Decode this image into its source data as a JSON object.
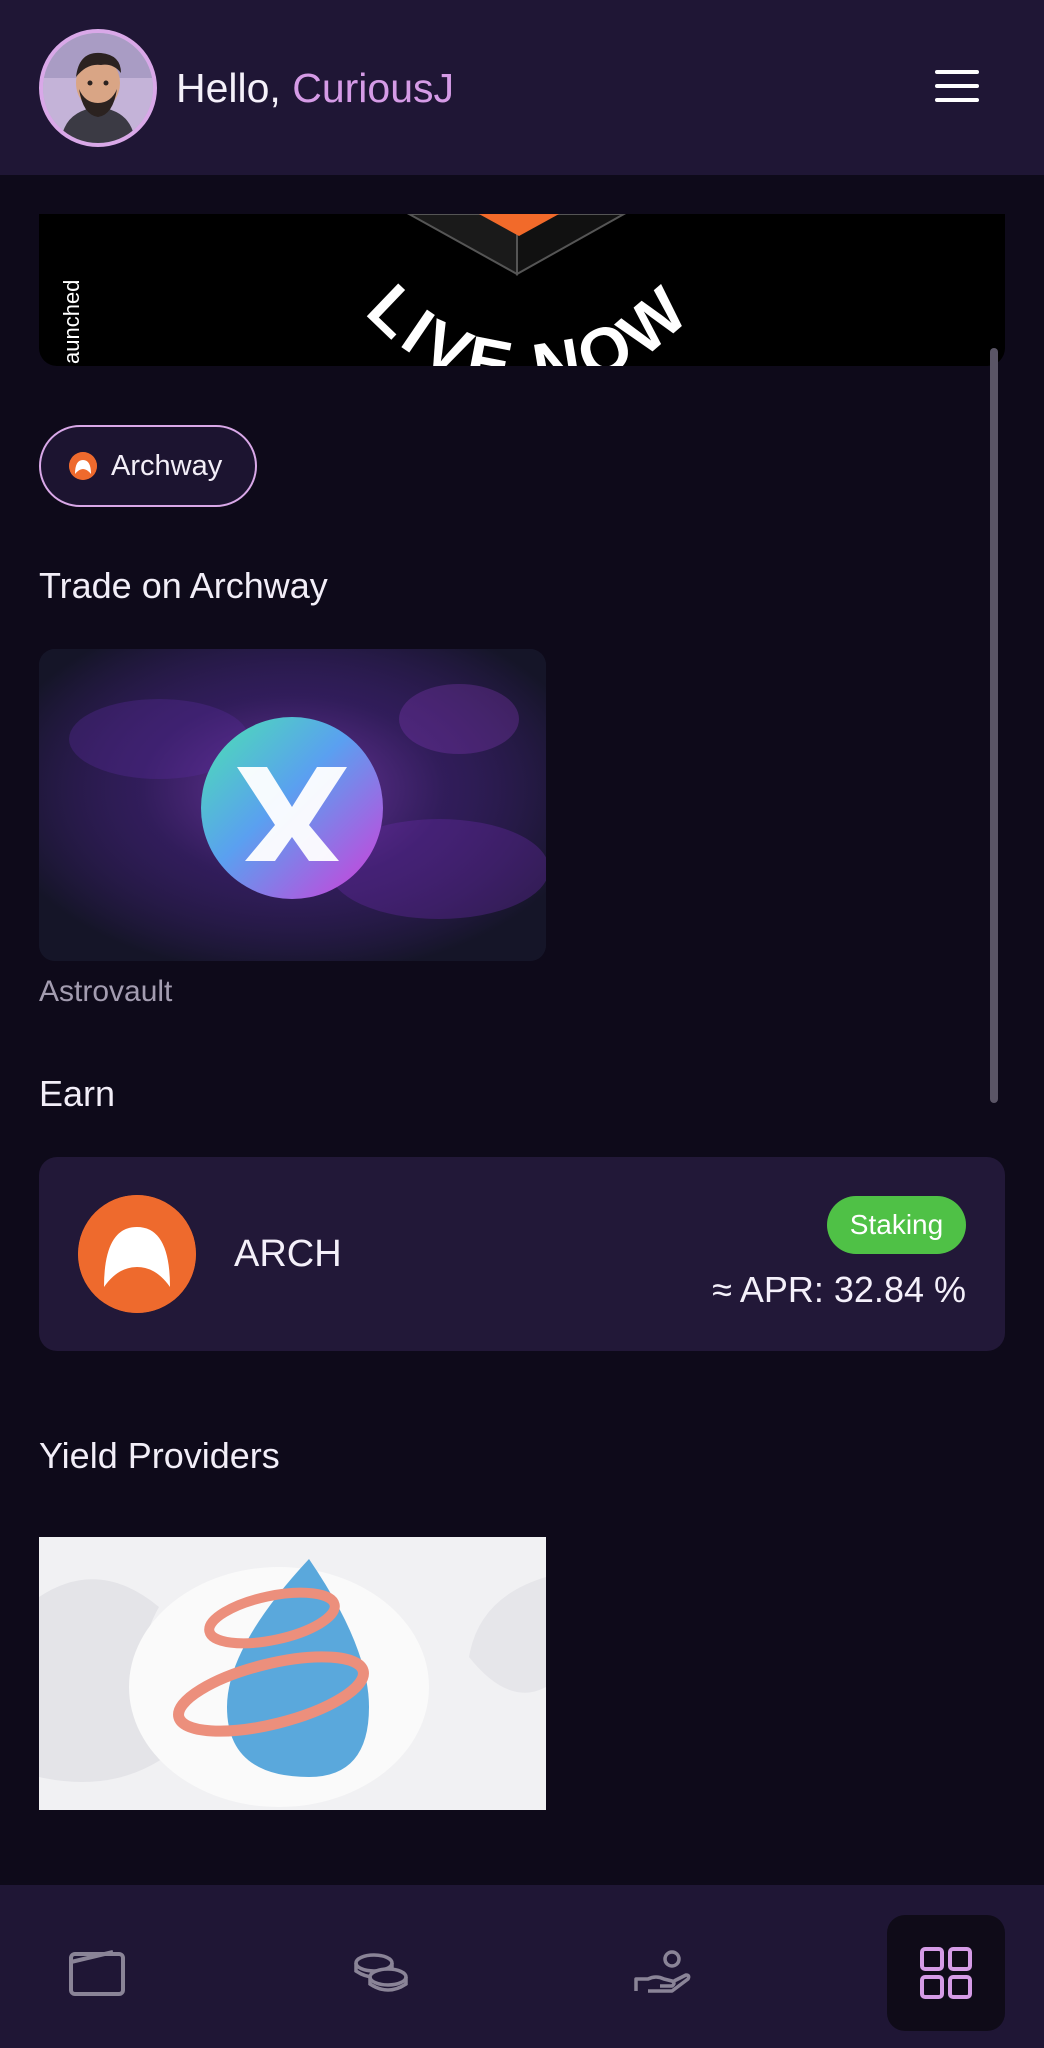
{
  "header": {
    "greeting_prefix": "Hello,",
    "username": "CuriousJ",
    "avatar_icon": "user-avatar",
    "menu_icon": "hamburger-menu-icon"
  },
  "banner": {
    "side_text": "aunched",
    "arc_text": "LIVE NOW"
  },
  "network_chip": {
    "label": "Archway",
    "icon": "archway-logo-icon"
  },
  "trade": {
    "title": "Trade on Archway",
    "apps": [
      {
        "name": "Astrovault",
        "icon": "astrovault-logo"
      }
    ]
  },
  "earn": {
    "title": "Earn",
    "items": [
      {
        "token": "ARCH",
        "badge": "Staking",
        "apr": "≈ APR: 32.84 %"
      }
    ]
  },
  "yield": {
    "title": "Yield Providers",
    "providers": [
      {
        "icon": "water-drop-rings-logo"
      }
    ]
  },
  "bottom_nav": {
    "items": [
      {
        "icon": "wallet-icon",
        "active": false
      },
      {
        "icon": "coins-icon",
        "active": false
      },
      {
        "icon": "hand-coin-icon",
        "active": false
      },
      {
        "icon": "grid-icon",
        "active": true
      }
    ]
  },
  "colors": {
    "background": "#0e0a1a",
    "header": "#1f1635",
    "accent": "#d59be6",
    "archway_orange": "#ee6a2d",
    "staking_green": "#4fc146",
    "card": "#221838"
  }
}
